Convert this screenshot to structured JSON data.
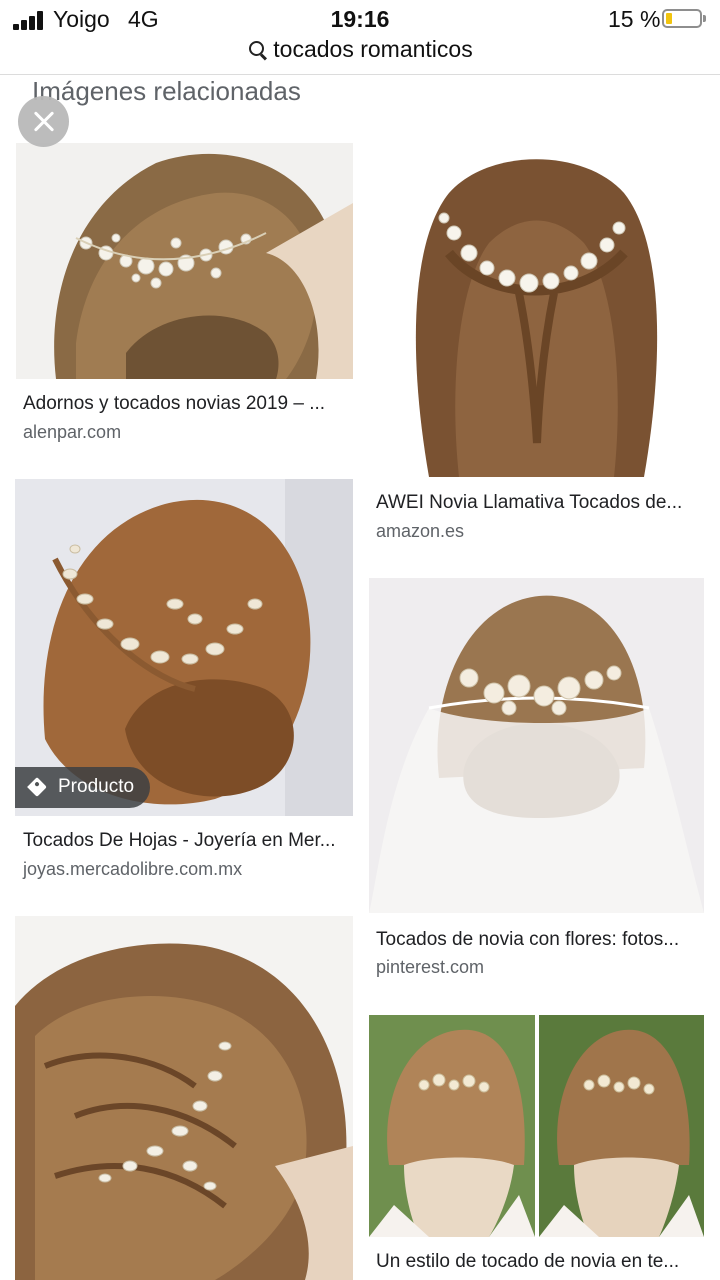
{
  "status_bar": {
    "carrier": "Yoigo",
    "network": "4G",
    "time": "19:16",
    "battery_percent": "15 %",
    "battery_level": 0.15,
    "battery_color": "#f1c40f"
  },
  "search": {
    "query": "tocados romanticos"
  },
  "section": {
    "title": "Imágenes relacionadas"
  },
  "results": [
    {
      "title": "Adornos y tocados novias 2019 – ...",
      "source": "alenpar.com"
    },
    {
      "title": "AWEI Novia Llamativa Tocados de...",
      "source": "amazon.es"
    },
    {
      "title": "Tocados De Hojas - Joyería en Mer...",
      "source": "joyas.mercadolibre.com.mx",
      "badge": "Producto"
    },
    {
      "title": "Tocados de novia con flores: fotos...",
      "source": "pinterest.com"
    },
    {
      "title": "",
      "source": ""
    },
    {
      "title": "Un estilo de tocado de novia en te...",
      "source": ""
    }
  ],
  "colors": {
    "title_text": "#202124",
    "source_text": "#5f6368",
    "heading_text": "#5f6368"
  }
}
